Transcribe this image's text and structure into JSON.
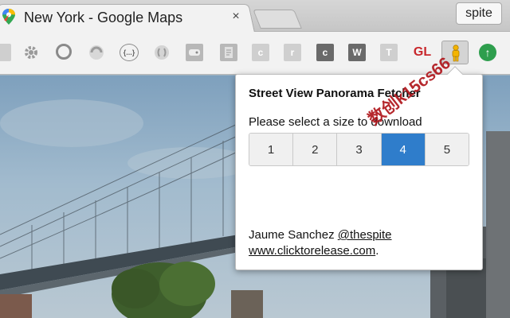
{
  "tab": {
    "title": "New York - Google Maps",
    "close_glyph": "×"
  },
  "profile": {
    "label": "spite"
  },
  "extensions": [
    {
      "name": "camera-icon"
    },
    {
      "name": "gear-icon"
    },
    {
      "name": "circle-icon"
    },
    {
      "name": "swirl-icon"
    },
    {
      "name": "json-icon",
      "label": "{...}"
    },
    {
      "name": "bracket-icon"
    },
    {
      "name": "gamepad-icon"
    },
    {
      "name": "document-icon"
    },
    {
      "name": "c-icon",
      "label": "c"
    },
    {
      "name": "r-icon",
      "label": "r"
    },
    {
      "name": "c-dark-icon",
      "label": "c"
    },
    {
      "name": "w-icon",
      "label": "W"
    },
    {
      "name": "t-icon",
      "label": "T"
    },
    {
      "name": "gl-icon",
      "label": "GL"
    },
    {
      "name": "pegman-icon"
    },
    {
      "name": "upload-icon",
      "label": "↑"
    }
  ],
  "popup": {
    "title": "Street View Panorama Fetcher",
    "prompt": "Please select a size to download",
    "sizes": [
      "1",
      "2",
      "3",
      "4",
      "5"
    ],
    "selected_size": "4",
    "credit_name": "Jaume Sanchez",
    "credit_handle": "@thespite",
    "credit_site": "www.clicktorelease.com",
    "credit_site_suffix": "."
  },
  "watermark": "数创k15cs66",
  "colors": {
    "accent": "#2f7dcb",
    "gl": "#c8262b",
    "upload": "#2e9e4d"
  }
}
